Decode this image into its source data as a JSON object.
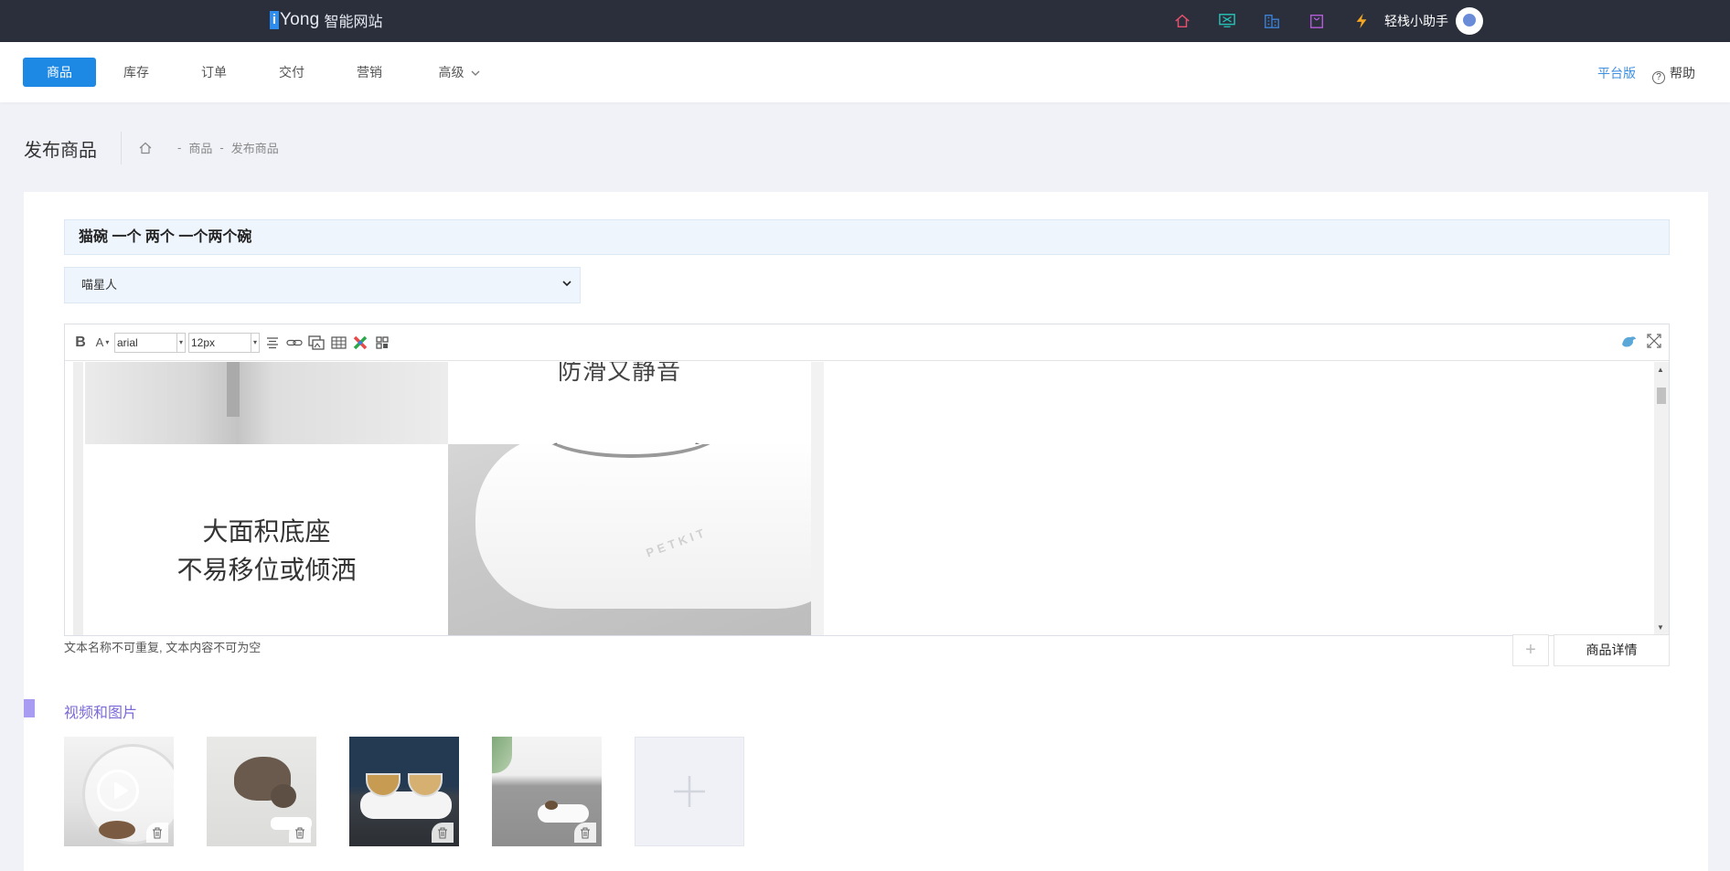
{
  "topbar": {
    "logo_mark": "i",
    "logo_name": "Yong",
    "logo_suffix": "智能网站",
    "icons": [
      "home-icon",
      "monitor-icon",
      "building-icon",
      "bag-icon",
      "lightning-icon"
    ],
    "icon_colors": [
      "#e8506d",
      "#26c2b8",
      "#3b82d8",
      "#b25bd6",
      "#f5a623"
    ],
    "user_name": "轻栈小助手"
  },
  "nav": {
    "tabs": [
      {
        "label": "商品",
        "active": true
      },
      {
        "label": "库存"
      },
      {
        "label": "订单"
      },
      {
        "label": "交付"
      },
      {
        "label": "营销"
      },
      {
        "label": "高级",
        "has_dropdown": true
      }
    ],
    "platform_link": "平台版",
    "help_label": "帮助",
    "accent_color": "#1e88e5"
  },
  "page": {
    "title": "发布商品",
    "breadcrumb": {
      "sep": "-",
      "items": [
        "商品",
        "发布商品"
      ]
    }
  },
  "form": {
    "title_value": "猫碗 一个 两个 一个两个碗",
    "category_value": "喵星人"
  },
  "editor": {
    "font_family": "arial",
    "font_size": "12px",
    "content": {
      "top_text_cut": "防滑又静音",
      "caption_line1": "大面积底座",
      "caption_line2": "不易移位或倾洒",
      "product_brand": "PETKIT"
    },
    "hint": "文本名称不可重复, 文本内容不可为空",
    "add_button_symbol": "+",
    "tab_label": "商品详情"
  },
  "media": {
    "section_title": "视频和图片",
    "accent_color": "#a89cf2",
    "items": [
      {
        "kind": "video",
        "subject": "glass cat bowl with food"
      },
      {
        "kind": "image",
        "subject": "cat eating from bowl"
      },
      {
        "kind": "image",
        "subject": "double bowl on stand"
      },
      {
        "kind": "image",
        "subject": "bowl on grey rug"
      }
    ],
    "add_symbol": "+"
  }
}
